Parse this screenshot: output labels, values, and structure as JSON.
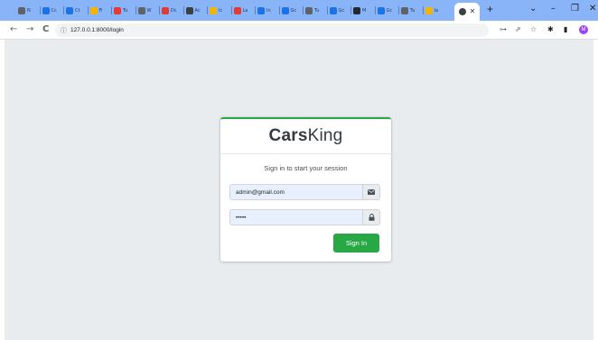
{
  "browser": {
    "tabs": [
      {
        "label": "N",
        "color": "#5f6368"
      },
      {
        "label": "Cc",
        "color": "#1a73e8"
      },
      {
        "label": "Ct",
        "color": "#1a73e8"
      },
      {
        "label": "Fi",
        "color": "#f4b400"
      },
      {
        "label": "Tu",
        "color": "#e53935"
      },
      {
        "label": "W",
        "color": "#5f6368"
      },
      {
        "label": "Dc",
        "color": "#e53935"
      },
      {
        "label": "Ac",
        "color": "#3c4043"
      },
      {
        "label": "Ic",
        "color": "#f4b400"
      },
      {
        "label": "La",
        "color": "#e53935"
      },
      {
        "label": "In",
        "color": "#1a73e8"
      },
      {
        "label": "Gc",
        "color": "#1a73e8"
      },
      {
        "label": "Tu",
        "color": "#5f6368"
      },
      {
        "label": "Gc",
        "color": "#1a73e8"
      },
      {
        "label": "M",
        "color": "#24292e"
      },
      {
        "label": "Gc",
        "color": "#1a73e8"
      },
      {
        "label": "Tu",
        "color": "#5f6368"
      },
      {
        "label": "Ia",
        "color": "#f4b400"
      }
    ],
    "new_tab": "+",
    "window_controls": {
      "dropdown": "⌄",
      "minimize": "–",
      "maximize": "❐",
      "close": "✕"
    },
    "nav": {
      "back": "←",
      "forward": "→",
      "reload": "C"
    },
    "url": "127.0.0.1:8000/login",
    "url_info_icon": "ⓘ",
    "toolbar_icons": {
      "key": "⊶",
      "share": "⇗",
      "star": "☆",
      "extensions": "✱",
      "sidebar": "▮"
    },
    "profile_initial": "M"
  },
  "login": {
    "logo_bold": "Cars",
    "logo_regular": "King",
    "message": "Sign in to start your session",
    "email_value": "admin@gmail.com",
    "email_icon": "envelope-icon",
    "password_value": "•••••",
    "password_icon": "lock-icon",
    "signin_label": "Sign In",
    "accent_color": "#28a745"
  }
}
